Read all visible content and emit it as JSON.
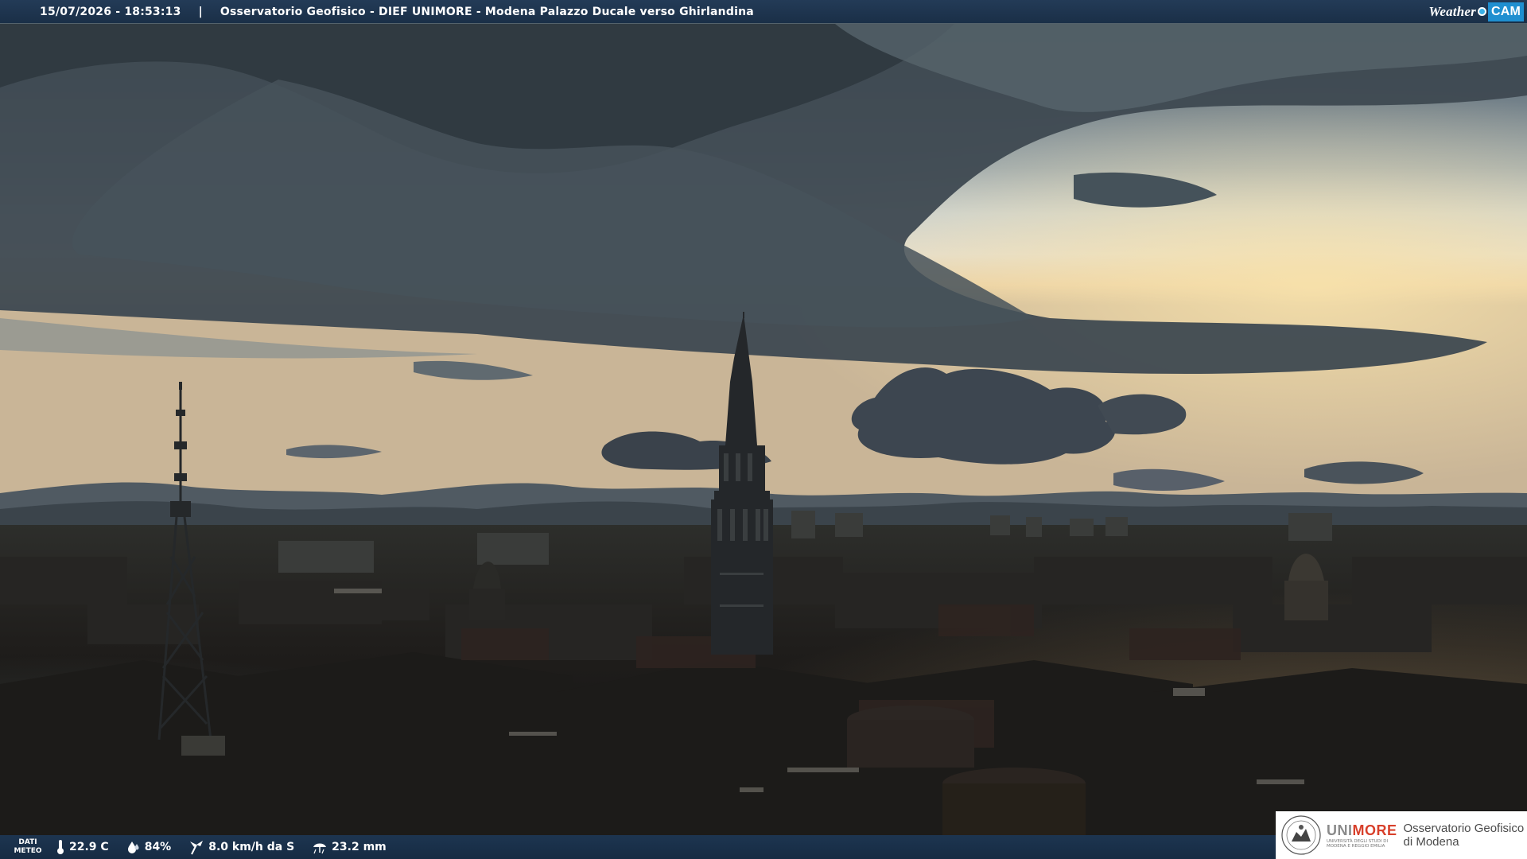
{
  "header": {
    "timestamp": "15/07/2026 - 18:53:13",
    "separator": "|",
    "title": "Osservatorio Geofisico - DIEF UNIMORE - Modena Palazzo Ducale verso Ghirlandina",
    "brand_weather": "Weather",
    "brand_cam": "CAM"
  },
  "weather": {
    "section_label_1": "DATI",
    "section_label_2": "METEO",
    "temperature": "22.9 C",
    "humidity": "84%",
    "wind": "8.0 km/h da S",
    "rain": "23.2 mm",
    "icons": [
      "thermometer-icon",
      "humidity-drop-icon",
      "wind-icon",
      "rain-icon"
    ]
  },
  "logo": {
    "uni_prefix": "UNI",
    "uni_suffix": "MORE",
    "uni_full": "UNIVERSITÀ DEGLI STUDI DI MODENA E REGGIO EMILIA",
    "observatory_line1": "Osservatorio Geofisico",
    "observatory_line2": "di Modena"
  },
  "colors": {
    "bar": "#1d3550",
    "accent": "#1f8fd0",
    "unimore_red": "#d8402b"
  }
}
